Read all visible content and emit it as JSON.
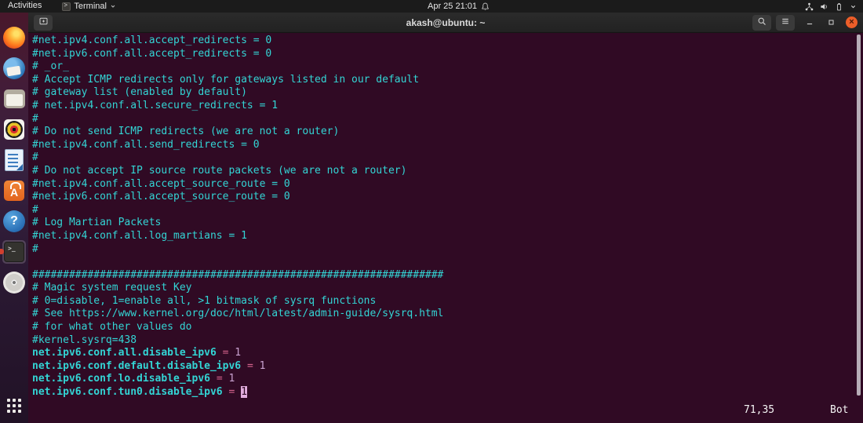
{
  "top_bar": {
    "activities_label": "Activities",
    "app_menu_label": "Terminal",
    "clock": "Apr 25 21:01",
    "right_icons": [
      "network-icon",
      "volume-icon",
      "battery-icon",
      "chevron-down-icon"
    ]
  },
  "dock": {
    "items": [
      {
        "icon": "firefox-icon"
      },
      {
        "icon": "thunderbird-icon"
      },
      {
        "icon": "files-icon"
      },
      {
        "icon": "rhythmbox-icon"
      },
      {
        "icon": "libreoffice-writer-icon"
      },
      {
        "icon": "ubuntu-software-icon"
      },
      {
        "icon": "help-icon"
      },
      {
        "icon": "terminal-icon",
        "active": true
      },
      {
        "icon": "disk-icon"
      }
    ],
    "show_apps_icon": "show-applications-icon"
  },
  "terminal": {
    "header": {
      "title": "akash@ubuntu: ~",
      "buttons": [
        "new-tab-icon",
        "search-icon",
        "menu-icon",
        "minimize-icon",
        "maximize-icon",
        "close-icon"
      ]
    },
    "lines": [
      {
        "t": "comment",
        "text": "#net.ipv4.conf.all.accept_redirects = 0"
      },
      {
        "t": "comment",
        "text": "#net.ipv6.conf.all.accept_redirects = 0"
      },
      {
        "t": "comment",
        "text": "# _or_"
      },
      {
        "t": "comment",
        "text": "# Accept ICMP redirects only for gateways listed in our default"
      },
      {
        "t": "comment",
        "text": "# gateway list (enabled by default)"
      },
      {
        "t": "comment",
        "text": "# net.ipv4.conf.all.secure_redirects = 1"
      },
      {
        "t": "comment",
        "text": "#"
      },
      {
        "t": "comment",
        "text": "# Do not send ICMP redirects (we are not a router)"
      },
      {
        "t": "comment",
        "text": "#net.ipv4.conf.all.send_redirects = 0"
      },
      {
        "t": "comment",
        "text": "#"
      },
      {
        "t": "comment",
        "text": "# Do not accept IP source route packets (we are not a router)"
      },
      {
        "t": "comment",
        "text": "#net.ipv4.conf.all.accept_source_route = 0"
      },
      {
        "t": "comment",
        "text": "#net.ipv6.conf.all.accept_source_route = 0"
      },
      {
        "t": "comment",
        "text": "#"
      },
      {
        "t": "comment",
        "text": "# Log Martian Packets"
      },
      {
        "t": "comment",
        "text": "#net.ipv4.conf.all.log_martians = 1"
      },
      {
        "t": "comment",
        "text": "#"
      },
      {
        "t": "blank",
        "text": ""
      },
      {
        "t": "comment",
        "text": "###################################################################"
      },
      {
        "t": "comment",
        "text": "# Magic system request Key"
      },
      {
        "t": "comment",
        "text": "# 0=disable, 1=enable all, >1 bitmask of sysrq functions"
      },
      {
        "t": "comment",
        "text": "# See https://www.kernel.org/doc/html/latest/admin-guide/sysrq.html"
      },
      {
        "t": "comment",
        "text": "# for what other values do"
      },
      {
        "t": "comment",
        "text": "#kernel.sysrq=438"
      },
      {
        "t": "config",
        "key": "net.ipv6.conf.all.disable_ipv6",
        "op": "=",
        "value": "1"
      },
      {
        "t": "config",
        "key": "net.ipv6.conf.default.disable_ipv6",
        "op": "=",
        "value": "1"
      },
      {
        "t": "config",
        "key": "net.ipv6.conf.lo.disable_ipv6",
        "op": "=",
        "value": "1"
      },
      {
        "t": "config",
        "key": "net.ipv6.conf.tun0.disable_ipv6",
        "op": "=",
        "value": "1",
        "cursor": true
      }
    ],
    "ruler": {
      "position": "71,35",
      "scroll": "Bot"
    }
  },
  "colors": {
    "terminal_background": "#300a24",
    "comment_text": "#33d5d5",
    "operator_text": "#d7648e",
    "value_text": "#c9a2d0",
    "cursor_background": "#e2aede",
    "close_button": "#ec5e29",
    "active_dot": "#d2402f"
  }
}
